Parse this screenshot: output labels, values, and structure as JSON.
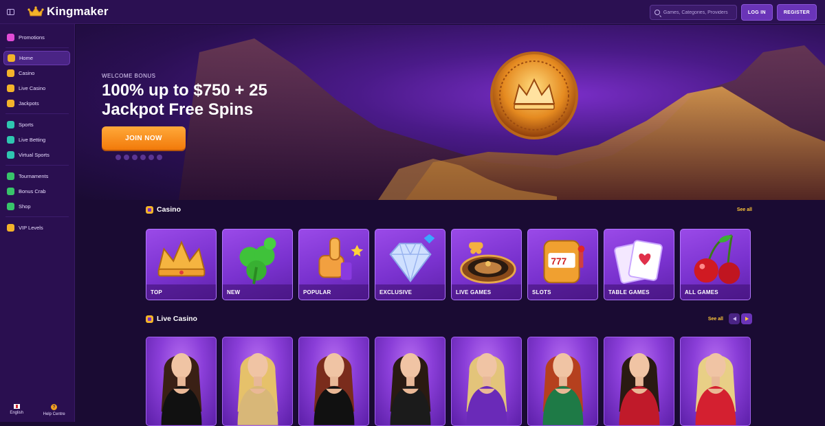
{
  "colors": {
    "accent": "#f27a0a",
    "primary_purple": "#6a34b8",
    "gold": "#ffc83a",
    "background": "#1a0b33"
  },
  "header": {
    "brand": "Kingmaker",
    "search_placeholder": "Games, Categories, Providers",
    "login_label": "LOG IN",
    "register_label": "REGISTER"
  },
  "sidebar": {
    "items": [
      {
        "label": "Promotions",
        "icon": "gift-icon",
        "color": "#e14bd6"
      },
      {
        "label": "Home",
        "icon": "home-icon",
        "color": "#f3b32a",
        "active": true
      },
      {
        "label": "Casino",
        "icon": "casino-icon",
        "color": "#f3b32a"
      },
      {
        "label": "Live Casino",
        "icon": "live-casino-icon",
        "color": "#f3b32a"
      },
      {
        "label": "Jackpots",
        "icon": "jackpot-icon",
        "color": "#f3b32a"
      },
      {
        "label": "Sports",
        "icon": "sports-ball-icon",
        "color": "#2fc6b0"
      },
      {
        "label": "Live Betting",
        "icon": "live-betting-icon",
        "color": "#2fc6b0"
      },
      {
        "label": "Virtual Sports",
        "icon": "gamepad-icon",
        "color": "#2fc6b0"
      },
      {
        "label": "Tournaments",
        "icon": "trophy-icon",
        "color": "#38c46a"
      },
      {
        "label": "Bonus Crab",
        "icon": "bonus-crab-icon",
        "color": "#38c46a"
      },
      {
        "label": "Shop",
        "icon": "shop-icon",
        "color": "#38c46a"
      },
      {
        "label": "VIP Levels",
        "icon": "crown-icon",
        "color": "#f3b32a"
      }
    ],
    "footer": {
      "language": "English",
      "help": "Help Centre"
    }
  },
  "hero": {
    "kicker": "WELCOME BONUS",
    "title": "100% up to $750 + 25 Jackpot Free Spins",
    "cta": "JOIN NOW",
    "payment_icons": [
      "visa-icon",
      "mastercard-icon",
      "bank-icon",
      "crypto-icon",
      "tether-icon",
      "bitcoin-icon"
    ]
  },
  "casino": {
    "title": "Casino",
    "see_all": "See all",
    "categories": [
      {
        "label": "TOP",
        "art": "crown"
      },
      {
        "label": "NEW",
        "art": "clover"
      },
      {
        "label": "POPULAR",
        "art": "thumbs-up"
      },
      {
        "label": "EXCLUSIVE",
        "art": "diamond"
      },
      {
        "label": "LIVE GAMES",
        "art": "roulette"
      },
      {
        "label": "SLOTS",
        "art": "slot-machine"
      },
      {
        "label": "TABLE GAMES",
        "art": "cards"
      },
      {
        "label": "ALL GAMES",
        "art": "cherries"
      }
    ]
  },
  "live_casino": {
    "title": "Live Casino",
    "see_all": "See all",
    "dealers": [
      {
        "hair": "#3a2015",
        "dress": "#111111"
      },
      {
        "hair": "#e6c16a",
        "dress": "#d8b778"
      },
      {
        "hair": "#7a2c1c",
        "dress": "#111111"
      },
      {
        "hair": "#2a1a12",
        "dress": "#1b1b1b"
      },
      {
        "hair": "#e3c47a",
        "dress": "#6a2ab8"
      },
      {
        "hair": "#b5401e",
        "dress": "#1e7a46"
      },
      {
        "hair": "#2a1a12",
        "dress": "#c01a2a"
      },
      {
        "hair": "#e8cf86",
        "dress": "#d42030"
      }
    ]
  }
}
